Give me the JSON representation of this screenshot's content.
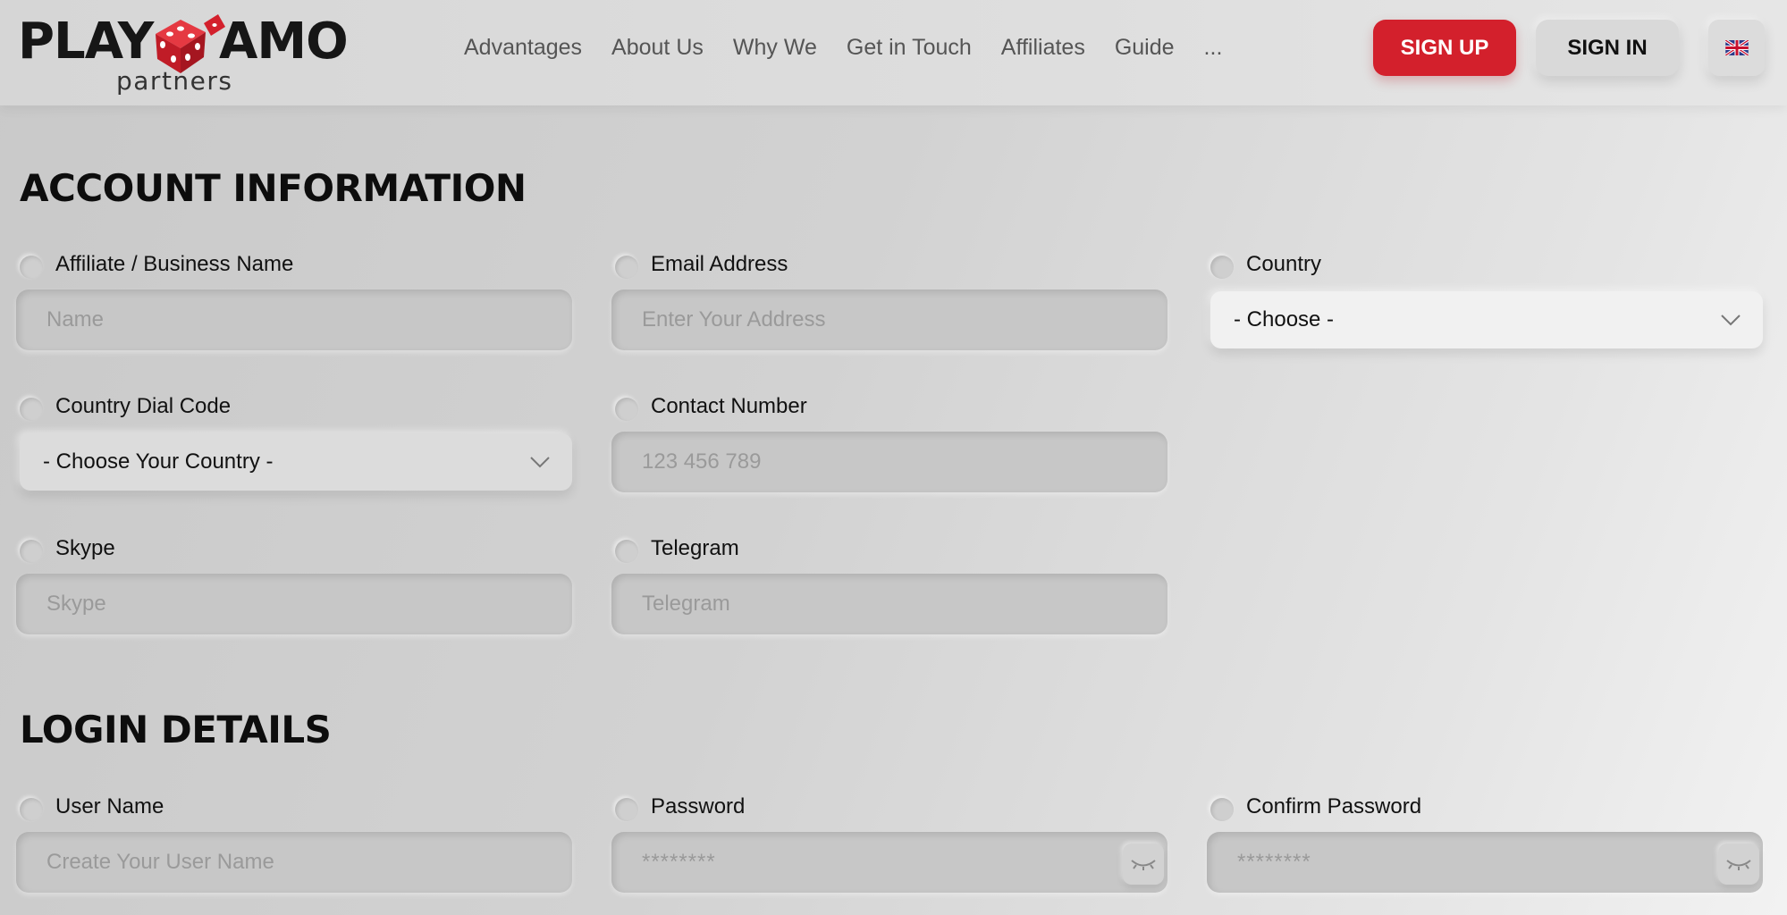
{
  "brand": {
    "word_left": "PLAY",
    "word_right": "AMO",
    "subtitle": "partners",
    "dice_color": "#d3202c"
  },
  "nav": {
    "items": [
      "Advantages",
      "About Us",
      "Why We",
      "Get in Touch",
      "Affiliates",
      "Guide",
      "..."
    ]
  },
  "header_actions": {
    "signup_label": "SIGN UP",
    "signin_label": "SIGN IN",
    "language_icon": "uk-flag-icon",
    "accent_color": "#d3202c"
  },
  "account": {
    "title": "ACCOUNT INFORMATION",
    "fields": {
      "business_name": {
        "label": "Affiliate / Business Name",
        "placeholder": "Name"
      },
      "email": {
        "label": "Email Address",
        "placeholder": "Enter Your Address"
      },
      "country": {
        "label": "Country",
        "value": "- Choose -"
      },
      "dial_code": {
        "label": "Country Dial Code",
        "value": "- Choose Your Country -"
      },
      "contact_number": {
        "label": "Contact Number",
        "placeholder": "123 456 789"
      },
      "skype": {
        "label": "Skype",
        "placeholder": "Skype"
      },
      "telegram": {
        "label": "Telegram",
        "placeholder": "Telegram"
      }
    }
  },
  "login": {
    "title": "LOGIN DETAILS",
    "fields": {
      "username": {
        "label": "User Name",
        "placeholder": "Create Your User Name"
      },
      "password": {
        "label": "Password",
        "placeholder": "********",
        "toggle_icon": "eye-closed-icon"
      },
      "confirm_password": {
        "label": "Confirm Password",
        "placeholder": "********",
        "toggle_icon": "eye-closed-icon"
      }
    }
  }
}
